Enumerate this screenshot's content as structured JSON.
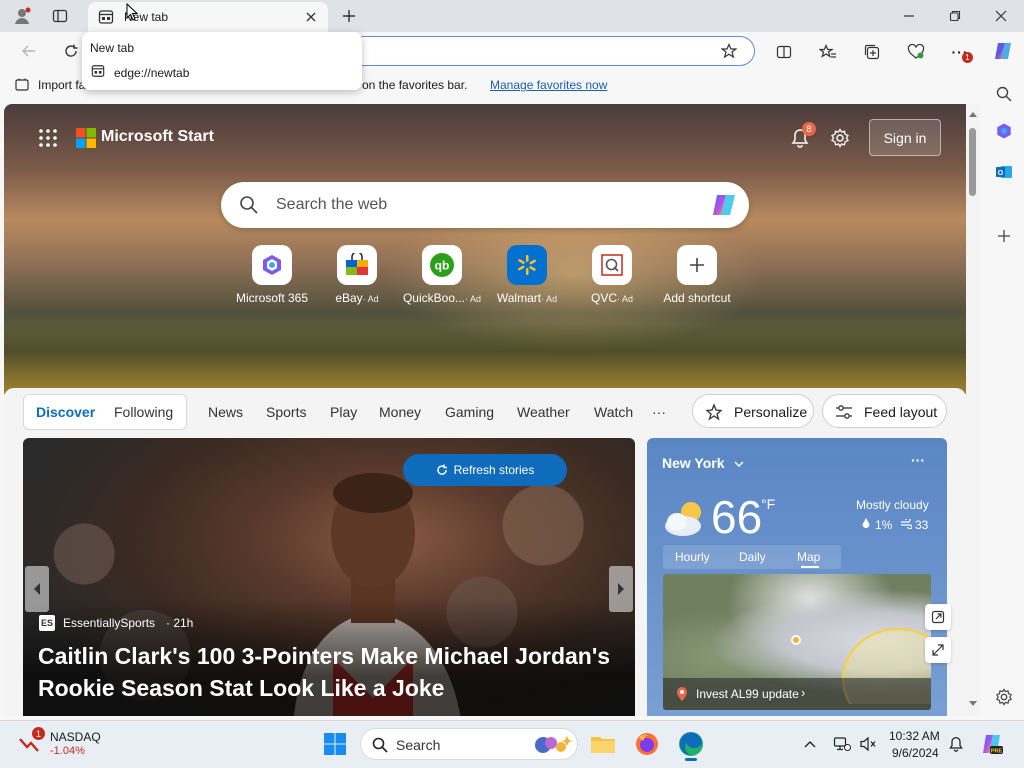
{
  "browser": {
    "tab": {
      "title": "New tab"
    },
    "tab_popup": {
      "title": "New tab",
      "url": "edge://newtab"
    },
    "favorites_bar": {
      "import_label": "Import fa",
      "hint_text": "re on the favorites bar.",
      "manage_link": "Manage favorites now"
    },
    "collections_badge": "1"
  },
  "msstart": {
    "brand": "Microsoft Start",
    "notification_count": "8",
    "sign_in": "Sign in",
    "search_placeholder": "Search the web",
    "shortcuts": [
      {
        "label": "Microsoft 365",
        "ad": ""
      },
      {
        "label": "eBay",
        "ad": "· Ad"
      },
      {
        "label": "QuickBoo...",
        "ad": "· Ad"
      },
      {
        "label": "Walmart",
        "ad": "· Ad"
      },
      {
        "label": "QVC",
        "ad": "· Ad"
      },
      {
        "label": "Add shortcut",
        "ad": ""
      }
    ],
    "feed_tabs": [
      "Discover",
      "Following"
    ],
    "nav_items": [
      "News",
      "Sports",
      "Play",
      "Money",
      "Gaming",
      "Weather",
      "Watch",
      "···"
    ],
    "personalize": "Personalize",
    "feed_layout": "Feed layout",
    "refresh": "Refresh stories",
    "story": {
      "source": "EssentiallySports",
      "age": "· 21h",
      "headline_line1": "Caitlin Clark's 100 3-Pointers Make Michael Jordan's",
      "headline_line2": "Rookie Season Stat Look Like a Joke"
    },
    "weather": {
      "location": "New York",
      "temp": "66",
      "unit": "°F",
      "condition": "Mostly cloudy",
      "precip": "1%",
      "aqi": "33",
      "tabs": [
        "Hourly",
        "Daily",
        "Map"
      ],
      "map_banner": "Invest AL99 update"
    }
  },
  "taskbar": {
    "stock_name": "NASDAQ",
    "stock_change": "-1.04%",
    "stock_badge": "1",
    "search_label": "Search",
    "time": "10:32 AM",
    "date": "9/6/2024"
  },
  "colors": {
    "accent": "#0f6cbd",
    "link": "#1a5fb4",
    "negative": "#c42b1c"
  }
}
